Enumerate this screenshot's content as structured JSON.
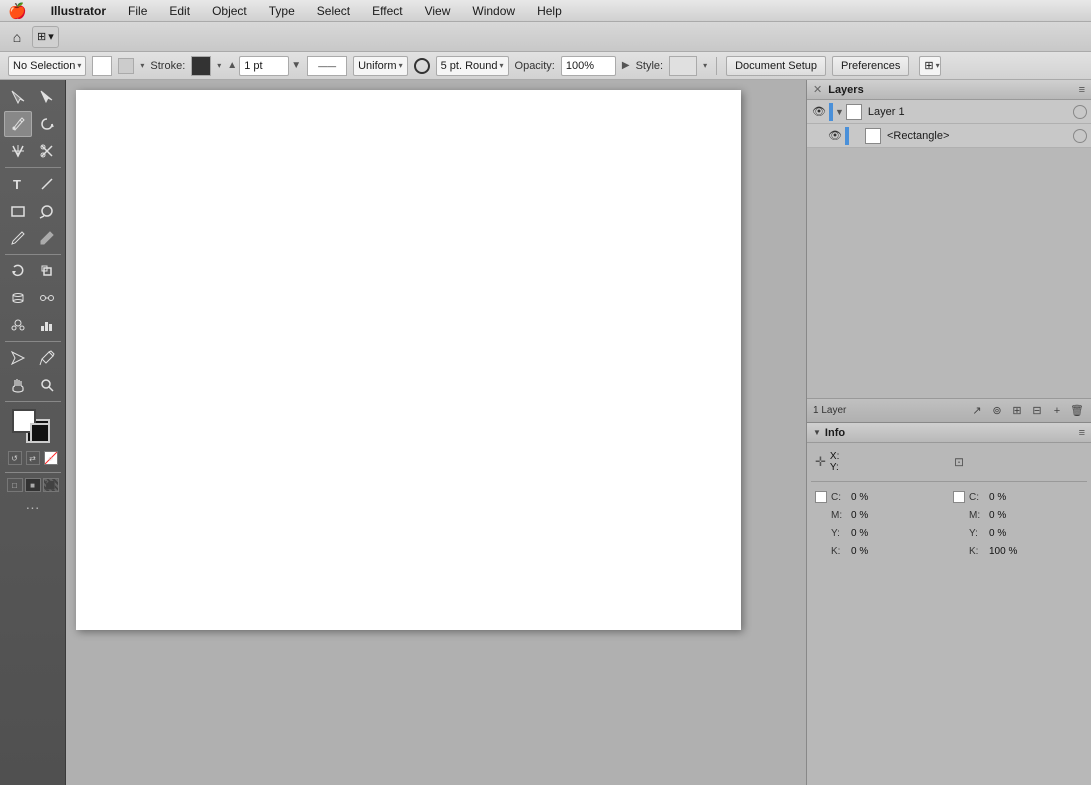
{
  "app": {
    "name": "Illustrator"
  },
  "menubar": {
    "apple": "🍎",
    "items": [
      "Illustrator",
      "File",
      "Edit",
      "Object",
      "Type",
      "Select",
      "Effect",
      "View",
      "Window",
      "Help"
    ]
  },
  "toolbar2": {
    "home_icon": "⌂",
    "layout_icon": "⊞"
  },
  "optionsBar": {
    "selection_label": "No Selection",
    "fill_label": "Fill:",
    "stroke_label": "Stroke:",
    "stroke_value": "1 pt",
    "stroke_type_label": "Uniform",
    "brush_label": "5 pt. Round",
    "opacity_label": "Opacity:",
    "opacity_value": "100%",
    "style_label": "Style:",
    "doc_setup_btn": "Document Setup",
    "preferences_btn": "Preferences"
  },
  "layers": {
    "panel_title": "Layers",
    "layer1_name": "Layer 1",
    "layer2_name": "<Rectangle>",
    "footer_count": "1 Layer",
    "icons": [
      "↗",
      "🔍",
      "🔲",
      "⊞",
      "+",
      "🗑"
    ]
  },
  "info": {
    "panel_title": "Info",
    "x_label": "X:",
    "y_label": "Y:",
    "coords": {
      "x": "",
      "y": ""
    },
    "cmyk_left": {
      "c": "C: 0 %",
      "m": "M: 0 %",
      "y": "Y: 0 %",
      "k": "K: 0 %"
    },
    "cmyk_right": {
      "c": "C: 0 %",
      "m": "M: 0 %",
      "y": "Y: 0 %",
      "k": "K: 100 %"
    }
  },
  "colors": {
    "accent_blue": "#3a7bd5",
    "layer_bar_blue": "#4a90d9",
    "bg_panel": "#b8b8b8",
    "bg_canvas": "#b0b0b0"
  }
}
